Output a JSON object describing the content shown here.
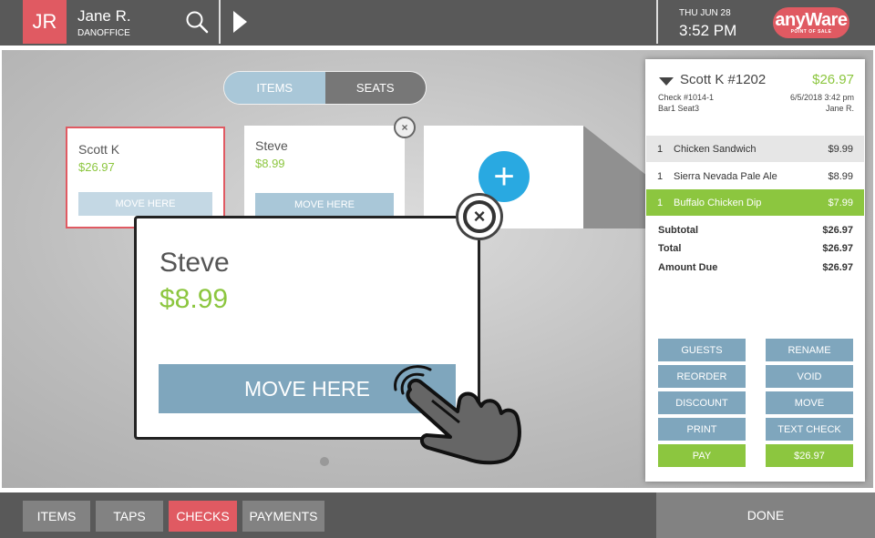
{
  "header": {
    "avatar_initials": "JR",
    "user_name": "Jane R.",
    "user_office": "DANOFFICE",
    "date": "THU JUN 28",
    "time": "3:52 PM",
    "logo_text": "anyWare",
    "logo_sub": "POINT OF SALE"
  },
  "toggle": {
    "items_label": "ITEMS",
    "seats_label": "SEATS"
  },
  "cards": [
    {
      "name": "Scott K",
      "price": "$26.97",
      "button": "MOVE HERE"
    },
    {
      "name": "Steve",
      "price": "$8.99",
      "button": "MOVE HERE"
    }
  ],
  "add_symbol": "+",
  "close_symbol": "×",
  "zoom": {
    "name": "Steve",
    "price": "$8.99",
    "button": "MOVE HERE"
  },
  "panel": {
    "title": "Scott K #1202",
    "total": "$26.97",
    "check_no": "Check #1014-1",
    "seat": "Bar1 Seat3",
    "datetime": "6/5/2018 3:42 pm",
    "server": "Jane R.",
    "items": [
      {
        "qty": "1",
        "name": "Chicken Sandwich",
        "price": "$9.99"
      },
      {
        "qty": "1",
        "name": "Sierra Nevada Pale Ale",
        "price": "$8.99"
      },
      {
        "qty": "1",
        "name": "Buffalo Chicken Dip",
        "price": "$7.99"
      }
    ],
    "subtotal_label": "Subtotal",
    "subtotal": "$26.97",
    "total_label": "Total",
    "total_value": "$26.97",
    "due_label": "Amount Due",
    "due": "$26.97",
    "buttons": {
      "guests": "GUESTS",
      "rename": "RENAME",
      "reorder": "REORDER",
      "void": "VOID",
      "discount": "DISCOUNT",
      "move": "MOVE",
      "print": "PRINT",
      "text_check": "TEXT CHECK",
      "pay": "PAY",
      "pay_amount": "$26.97"
    }
  },
  "bottom": {
    "tabs": [
      "ITEMS",
      "TAPS",
      "CHECKS",
      "PAYMENTS"
    ],
    "done": "DONE"
  },
  "colors": {
    "accent_red": "#e05a62",
    "accent_green": "#8cc63f",
    "button_blue": "#7fa6bd",
    "add_blue": "#29a9e1"
  }
}
